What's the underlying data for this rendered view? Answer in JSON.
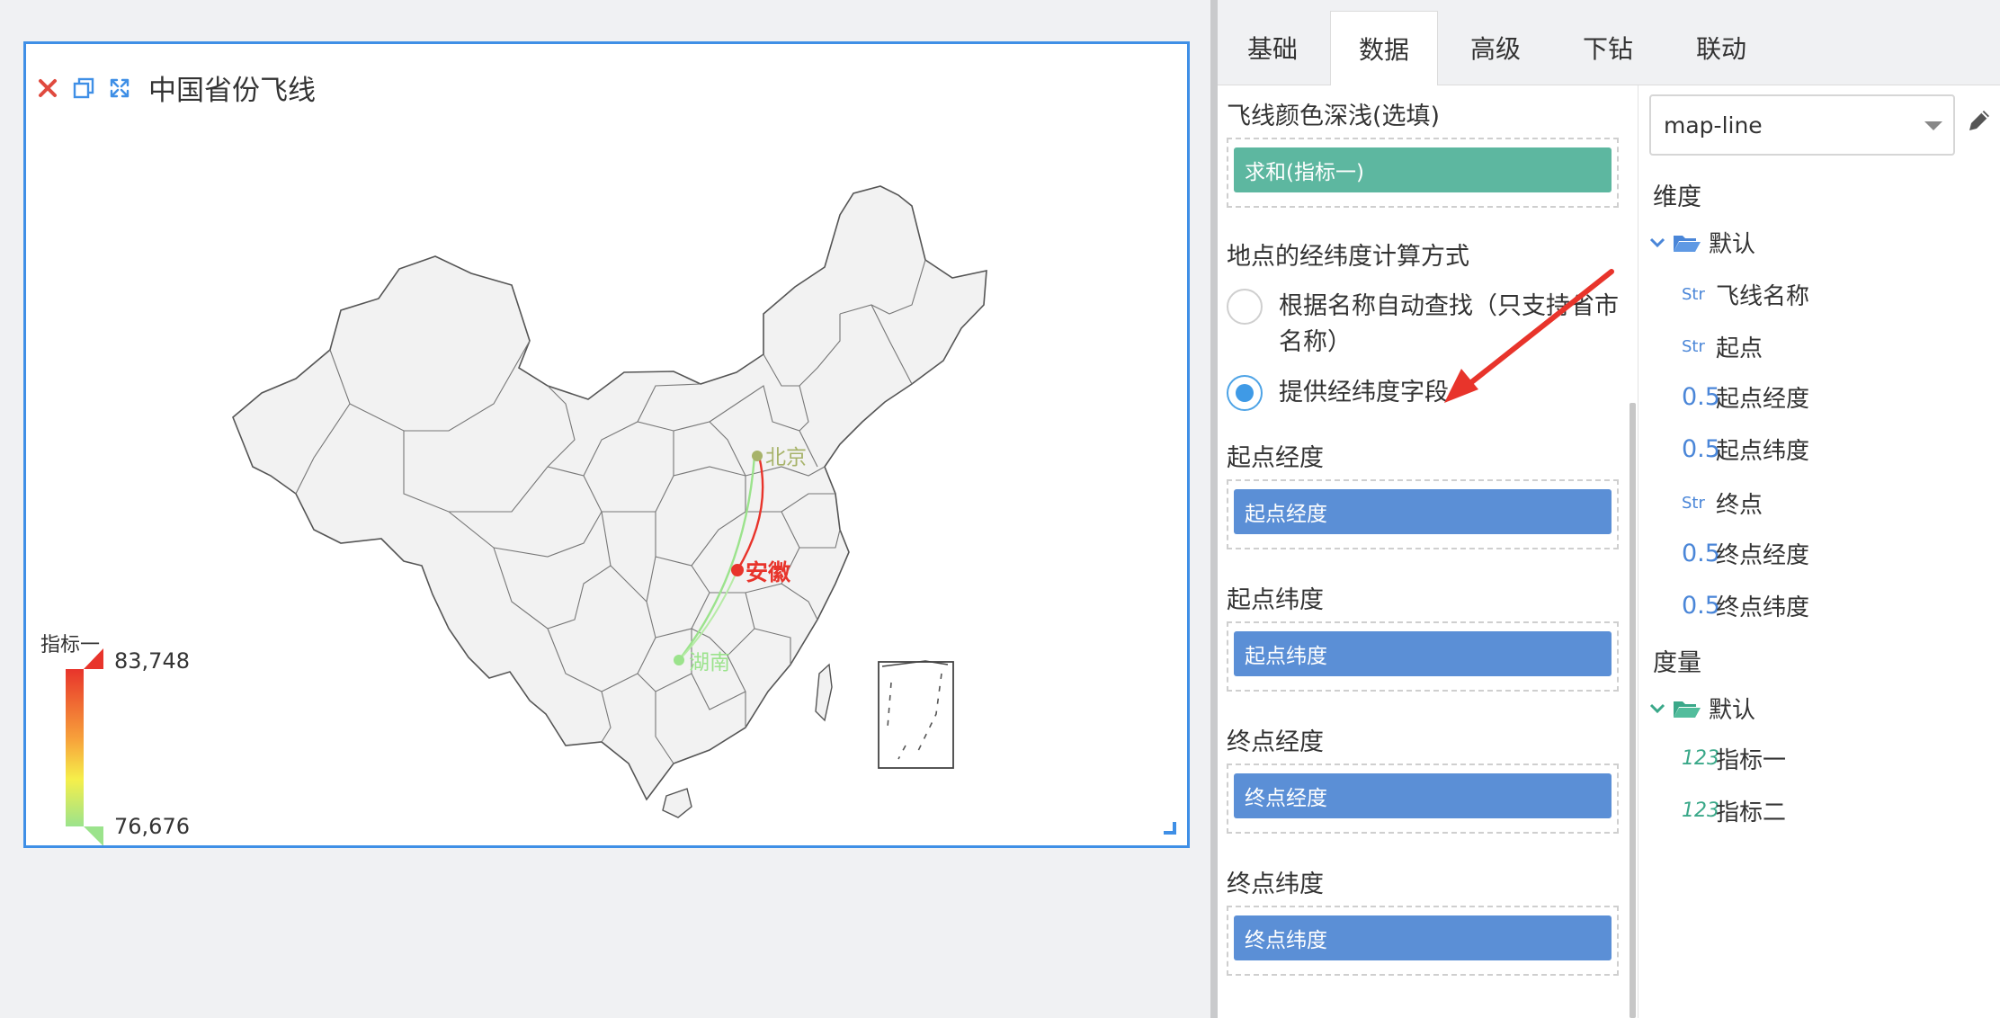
{
  "widget": {
    "title": "中国省份飞线",
    "cities": [
      {
        "name": "北京",
        "color": "#a7b36a"
      },
      {
        "name": "安徽",
        "color": "#e8342b"
      },
      {
        "name": "湖南",
        "color": "#9be38c"
      }
    ],
    "legend": {
      "title": "指标一",
      "max": "83,748",
      "min": "76,676",
      "max_color": "#e8342b",
      "min_color": "#9be38c"
    }
  },
  "tabs": [
    "基础",
    "数据",
    "高级",
    "下钻",
    "联动"
  ],
  "active_tab": "数据",
  "settings": {
    "line_color_label": "飞线颜色深浅(选填)",
    "line_color_chip": "求和(指标一)",
    "coord_method_label": "地点的经纬度计算方式",
    "option_auto": "根据名称自动查找（只支持省市名称）",
    "option_field": "提供经纬度字段",
    "selected_option": "option_field",
    "start_lng_label": "起点经度",
    "start_lng_chip": "起点经度",
    "start_lat_label": "起点纬度",
    "start_lat_chip": "起点纬度",
    "end_lng_label": "终点经度",
    "end_lng_chip": "终点经度",
    "end_lat_label": "终点纬度",
    "end_lat_chip": "终点纬度"
  },
  "fields": {
    "dataset": "map-line",
    "dimension_label": "维度",
    "dimension_folder": "默认",
    "dimensions": [
      {
        "type": "Str",
        "name": "飞线名称"
      },
      {
        "type": "Str",
        "name": "起点"
      },
      {
        "type": "0.5",
        "name": "起点经度"
      },
      {
        "type": "0.5",
        "name": "起点纬度"
      },
      {
        "type": "Str",
        "name": "终点"
      },
      {
        "type": "0.5",
        "name": "终点经度"
      },
      {
        "type": "0.5",
        "name": "终点纬度"
      }
    ],
    "measure_label": "度量",
    "measure_folder": "默认",
    "measures": [
      {
        "type": "123",
        "name": "指标一"
      },
      {
        "type": "123",
        "name": "指标二"
      }
    ]
  }
}
